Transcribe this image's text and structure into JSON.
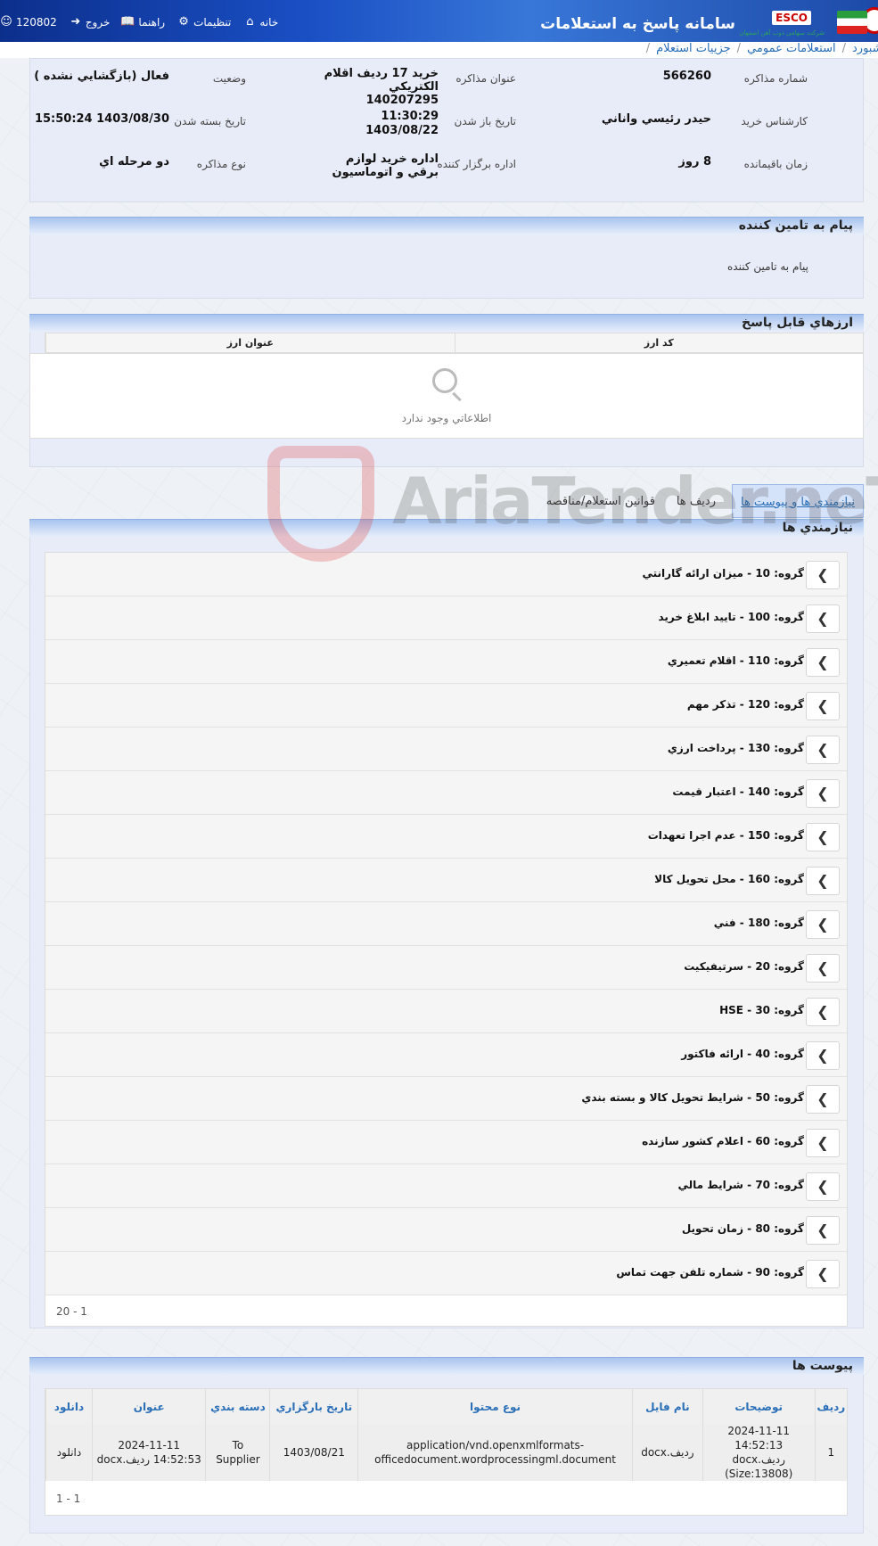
{
  "header": {
    "app_title": "سامانه پاسخ به استعلامات",
    "brand": "ESCO",
    "brand_sub": "شرکت سهامی ذوب آهن اصفهان",
    "nav": {
      "home": "خانه",
      "settings": "تنظیمات",
      "help": "راهنما",
      "logout": "خروج",
      "user": "120802"
    }
  },
  "breadcrumb": [
    "داشبورد",
    "استعلامات عمومي",
    "جزييات استعلام"
  ],
  "info": {
    "number_label": "شماره مذاكره",
    "number": "566260",
    "title_label": "عنوان مذاكره",
    "title": "خريد 17 رديف اقلام الكتريكي 140207295",
    "status_label": "وضعيت",
    "status": "فعال (بازگشايي نشده )",
    "expert_label": "كارشناس خريد",
    "expert": "حيدر رئيسي واناني",
    "open_label": "تاريخ باز شدن",
    "open_time": "11:30:29",
    "open_date": "1403/08/22",
    "close_label": "تاريخ بسته شدن",
    "close": "1403/08/30 15:50:24",
    "remaining_label": "زمان باقيمانده",
    "remaining": "8 روز",
    "dept_label": "اداره برگزار كننده",
    "dept": "اداره خريد لوازم برقي و اتوماسيون",
    "type_label": "نوع مذاكره",
    "type": "دو مرحله اي"
  },
  "supplier_msg": {
    "title": "پيام به تامين كننده",
    "body": "پيام به تامين كننده"
  },
  "currencies": {
    "title": "ارزهاي قابل پاسخ",
    "col_code": "كد ارز",
    "col_name": "عنوان ارز",
    "empty": "اطلاعاتي وجود ندارد"
  },
  "tabs": [
    "نيازمندي ها و پيوست ها",
    "رديف ها",
    "قوانين استعلام/مناقصه"
  ],
  "requirements": {
    "title": "نيازمندي ها",
    "groups": [
      "گروه: 10 - ميزان ارائه گارانتي",
      "گروه: 100 - تاييد ابلاغ خريد",
      "گروه: 110 - اقلام تعميري",
      "گروه: 120 - تذكر مهم",
      "گروه: 130 - پرداخت ارزي",
      "گروه: 140 - اعتبار قيمت",
      "گروه: 150 - عدم اجرا تعهدات",
      "گروه: 160 - محل تحويل كالا",
      "گروه: 180 - فني",
      "گروه: 20 - سرتيفيكيت",
      "گروه: 30 - HSE",
      "گروه: 40 - ارائه فاكتور",
      "گروه: 50 - شرايط تحويل كالا و بسته بندي",
      "گروه: 60 - اعلام كشور سازنده",
      "گروه: 70 - شرايط مالي",
      "گروه: 80 - زمان تحويل",
      "گروه: 90 - شماره تلفن جهت تماس"
    ],
    "pager": "1 - 20"
  },
  "attachments": {
    "title": "پيوست ها",
    "headers": [
      "رديف",
      "توضيحات",
      "نام فايل",
      "نوع محتوا",
      "تاريخ بارگزاري",
      "دسته بندي",
      "عنوان",
      "دانلود"
    ],
    "rows": [
      {
        "idx": "1",
        "desc": "2024-11-11 14:52:13 رديف.docx (Size:13808)",
        "file": "رديف.docx",
        "mime": "application/vnd.openxmlformats-officedocument.wordprocessingml.document",
        "date": "1403/08/21",
        "cat": "To Supplier",
        "title": "2024-11-11 14:52:53 رديف.docx",
        "download": "دانلود"
      }
    ],
    "pager": "1 - 1"
  },
  "watermark": "AriaTender.neT"
}
